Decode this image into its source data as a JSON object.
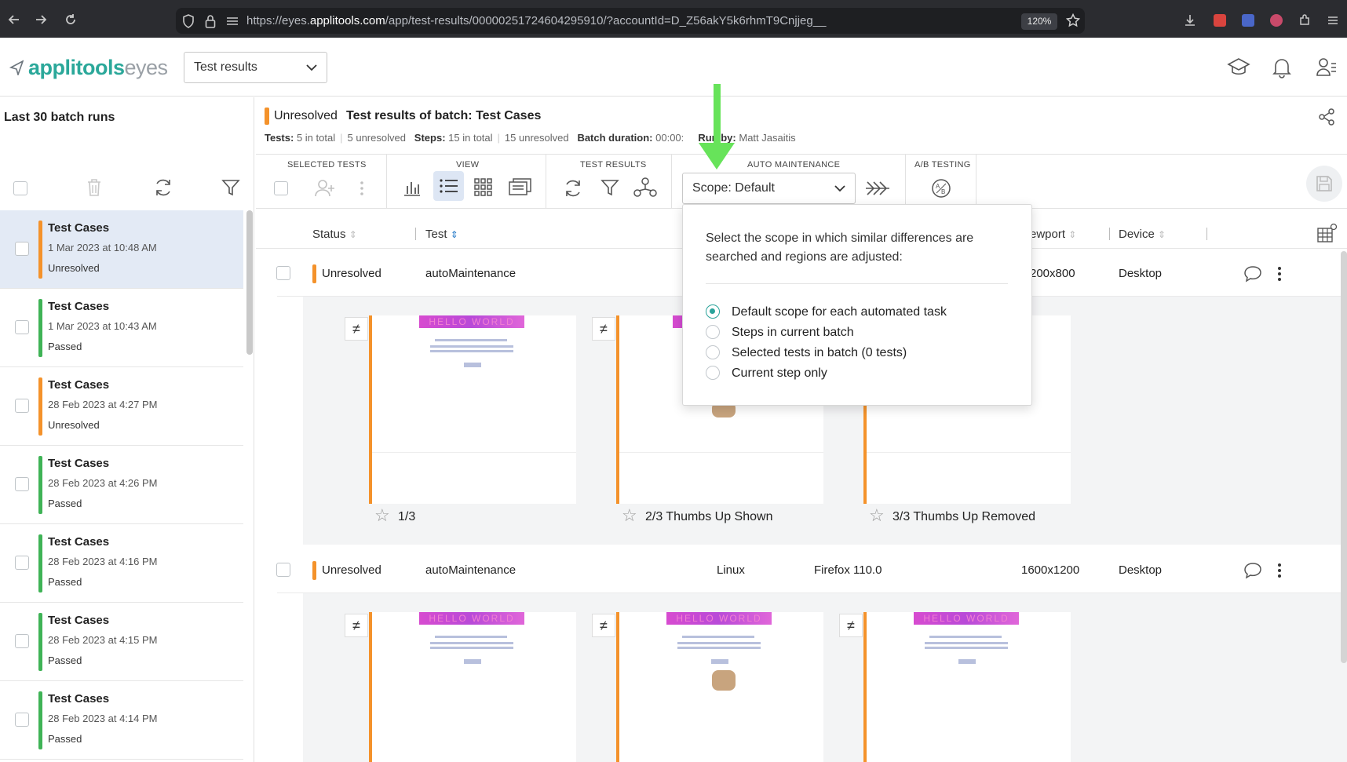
{
  "browser": {
    "url_prefix": "https://eyes.",
    "url_domain": "applitools.com",
    "url_rest": "/app/test-results/00000251724604295910/?accountId=D_Z56akY5k6rhmT9Cnjjeg__",
    "zoom": "120%"
  },
  "app": {
    "logo_brand": "applitools",
    "logo_product": "eyes",
    "page_selector": "Test results"
  },
  "sidebar": {
    "title": "Last 30 batch runs",
    "batches": [
      {
        "name": "Test Cases",
        "date": "1 Mar 2023 at 10:48 AM",
        "status": "Unresolved"
      },
      {
        "name": "Test Cases",
        "date": "1 Mar 2023 at 10:43 AM",
        "status": "Passed"
      },
      {
        "name": "Test Cases",
        "date": "28 Feb 2023 at 4:27 PM",
        "status": "Unresolved"
      },
      {
        "name": "Test Cases",
        "date": "28 Feb 2023 at 4:26 PM",
        "status": "Passed"
      },
      {
        "name": "Test Cases",
        "date": "28 Feb 2023 at 4:16 PM",
        "status": "Passed"
      },
      {
        "name": "Test Cases",
        "date": "28 Feb 2023 at 4:15 PM",
        "status": "Passed"
      },
      {
        "name": "Test Cases",
        "date": "28 Feb 2023 at 4:14 PM",
        "status": "Passed"
      }
    ]
  },
  "header": {
    "status": "Unresolved",
    "title": "Test results of batch: Test Cases",
    "tests_label": "Tests:",
    "tests_total": "5 in total",
    "tests_unresolved": "5 unresolved",
    "steps_label": "Steps:",
    "steps_total": "15 in total",
    "steps_unresolved": "15 unresolved",
    "duration_label": "Batch duration:",
    "duration_value": "00:00:",
    "runby_label": "Run by:",
    "runby_value": "Matt Jasaitis"
  },
  "toolbar": {
    "selected_tests": "SELECTED TESTS",
    "view": "VIEW",
    "test_results": "TEST RESULTS",
    "auto_maintenance": "AUTO MAINTENANCE",
    "ab_testing": "A/B TESTING",
    "scope_value": "Scope: Default"
  },
  "table": {
    "col_status": "Status",
    "col_test": "Test",
    "col_viewport": "ewport",
    "col_device": "Device",
    "rows": [
      {
        "status": "Unresolved",
        "test": "autoMaintenance",
        "os": "",
        "browser": "",
        "viewport": "200x800",
        "device": "Desktop"
      },
      {
        "status": "Unresolved",
        "test": "autoMaintenance",
        "os": "Linux",
        "browser": "Firefox 110.0",
        "viewport": "1600x1200",
        "device": "Desktop"
      }
    ],
    "thumbnails_row1": [
      {
        "caption": "1/3"
      },
      {
        "caption": "2/3 Thumbs Up Shown"
      },
      {
        "caption": "3/3 Thumbs Up Removed"
      }
    ]
  },
  "popup": {
    "description": "Select the scope in which similar differences are searched and regions are adjusted:",
    "options": [
      {
        "label": "Default scope for each automated task",
        "selected": true
      },
      {
        "label": "Steps in current batch",
        "selected": false
      },
      {
        "label": "Selected tests in batch (0 tests)",
        "selected": false
      },
      {
        "label": "Current step only",
        "selected": false
      }
    ]
  },
  "thumb_text": "HELLO WORLD",
  "colors": {
    "unresolved": "#f4922b",
    "passed": "#3fb356",
    "accent": "#2ba89a",
    "arrow": "#67e35a"
  }
}
